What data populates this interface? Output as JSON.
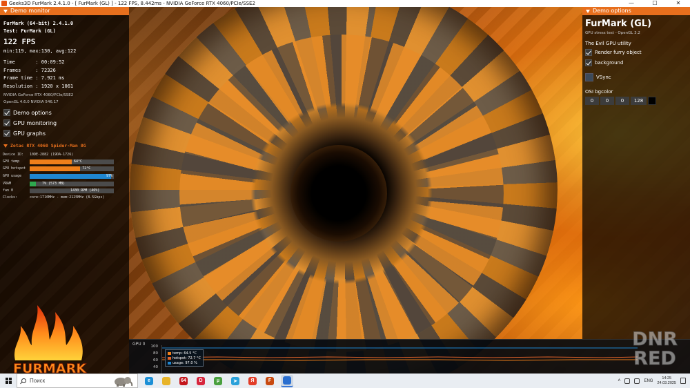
{
  "window": {
    "title": "Geeks3D FurMark 2.4.1.0 - [ FurMark (GL) ] - 122 FPS, 8.442ms - NVIDIA GeForce RTX 4060/PCIe/SSE2",
    "minimize": "—",
    "maximize": "☐",
    "close": "✕"
  },
  "monitor": {
    "header": "Demo monitor",
    "app": "FurMark (64-bit) 2.4.1.0",
    "test": "Test: FurMark (GL)",
    "fps": "122 FPS",
    "fps_stats": "min:119, max:130, avg:122",
    "time": "Time       : 00:09:52",
    "frames": "Frames     : 72326",
    "frame_time": "Frame time : 7.921 ms",
    "resolution": "Resolution : 1920 x 1061",
    "renderer": "NVIDIA GeForce RTX 4060/PCIe/SSE2",
    "opengl": "OpenGL 4.6.0 NVIDIA 546.17",
    "checks": [
      "Demo options",
      "GPU monitoring",
      "GPU graphs"
    ]
  },
  "gpu": {
    "name": "Zotac RTX 4060 Spider-Man 8G",
    "device_id_label": "Device ID:",
    "device_id": "10DE-2882 (19DA-1726)",
    "rows": [
      {
        "label": "GPU temp",
        "value": "64°C",
        "fraction": 0.5,
        "color": "#ef7f1a"
      },
      {
        "label": "GPU hotspot",
        "value": "72°C",
        "fraction": 0.6,
        "color": "#ef7f1a"
      },
      {
        "label": "GPU usage",
        "value": "97%",
        "fraction": 0.97,
        "color": "#1f86d0"
      },
      {
        "label": "VRAM",
        "value": "7% (573 MB)",
        "fraction": 0.07,
        "color": "#2fa84f"
      },
      {
        "label": "fan 0",
        "value": "1430 RPM (46%)",
        "fraction": 0.46,
        "color": "#4b4b4b"
      }
    ],
    "clocks_label": "Clocks:",
    "clocks": "core:1710MHz - mem:2125MHz (8.5Gbps)"
  },
  "options": {
    "header": "Demo options",
    "title": "FurMark (GL)",
    "subtitle": "GPU stress test - OpenGL 3.2",
    "utility": "The Evil GPU utility",
    "checks": [
      "Render furry object",
      "background"
    ],
    "vsync": "VSync",
    "bgcolor_label": "OSI bgcolor",
    "bgcolor": [
      "0",
      "0",
      "0",
      "128"
    ]
  },
  "graph": {
    "label": "GPU 0",
    "ticks": [
      "100",
      "80",
      "60",
      "40"
    ],
    "legend": [
      {
        "text": "temp: 64.5 °C",
        "color": "#ef7f1a"
      },
      {
        "text": "hotspot: 72.7 °C",
        "color": "#e0632a"
      },
      {
        "text": "usage: 97.0 %",
        "color": "#1f86d0"
      }
    ]
  },
  "logo_text": "FURMARK",
  "watermark": [
    "DNR",
    "RED"
  ],
  "taskbar": {
    "search_placeholder": "Поиск",
    "apps": [
      {
        "name": "edge",
        "label": "e",
        "color": "#1b8fd6"
      },
      {
        "name": "explorer",
        "label": "",
        "color": "#e8b42a"
      },
      {
        "name": "aida64",
        "label": "64",
        "color": "#c4161c"
      },
      {
        "name": "dnr",
        "label": "D",
        "color": "#d7263d"
      },
      {
        "name": "utorrent",
        "label": "µ",
        "color": "#4aa03f"
      },
      {
        "name": "telegram",
        "label": "➤",
        "color": "#2aa1da"
      },
      {
        "name": "yandex",
        "label": "Я",
        "color": "#e23d28"
      },
      {
        "name": "furmark",
        "label": "F",
        "color": "#c84a10"
      },
      {
        "name": "active-window",
        "label": "",
        "color": "#2a6fd0"
      }
    ],
    "lang": "ENG",
    "time": "14:25",
    "date": "24.03.2025"
  }
}
